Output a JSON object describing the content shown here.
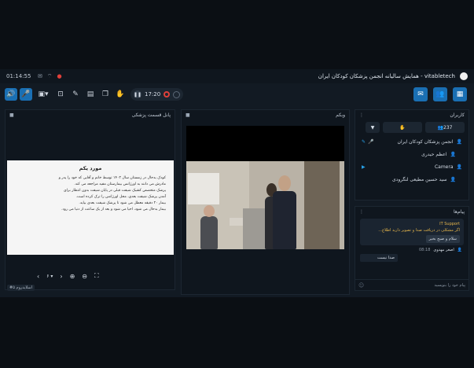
{
  "status": {
    "time": "01:14:55",
    "title": "vitabletech - همایش سالیانه انجمن پزشکان کودکان ایران"
  },
  "toolbar": {
    "timer": "17:20"
  },
  "doc_panel": {
    "title": "پانل قسمت پزشکی",
    "heading": "مورد یکم",
    "lines": [
      "کودک بدحال در زمستان سال ۱۴۰۲ توسط خانم و آقایی که خود را پدر و",
      "مادرش می دانند به اورژانس بیمارستان مفید مراجعه می کند.",
      "پزشک متخصص کشیک شیفت قبلی در پایان شیفت بدون انتظار برای",
      "آمدن پزشک شیفت بعدی، محل اورژانس را ترک کرده است.",
      "بیمار ۲۰ دقیقه معطل می شود تا پزشک شیفت بعدی بیاید.",
      "بیمار بدحال می شود، احیا می شود و بعد از یک ساعت از دنیا می رود."
    ],
    "page": "۶",
    "tag": "#اسلایدروم ۵"
  },
  "video_panel": {
    "title": "وبکم"
  },
  "users_panel": {
    "title": "کاربران",
    "count": "237",
    "users": [
      {
        "name": "انجمن پزشکان کودکان ایران"
      },
      {
        "name": "اعظم حیدری"
      },
      {
        "name": "Camera"
      },
      {
        "name": "سید حسین مطیعی لنگرودی"
      }
    ]
  },
  "chat_panel": {
    "title": "پیام‌ها",
    "support_sender": "IT Support",
    "support_text": "اگر مشکلی در دریافت صدا و تصویر دارید اطلاع...",
    "support_reply": "سلام و صبح بخیر",
    "msg2_time": "08:18",
    "msg2_sender": "اصغر مهدوی",
    "msg2_text": "صدا نیست",
    "input_placeholder": "پیام خود را بنویسید"
  },
  "colors": {
    "accent": "#1a6fb3",
    "support": "#e5b54b",
    "record": "#e0403a"
  }
}
